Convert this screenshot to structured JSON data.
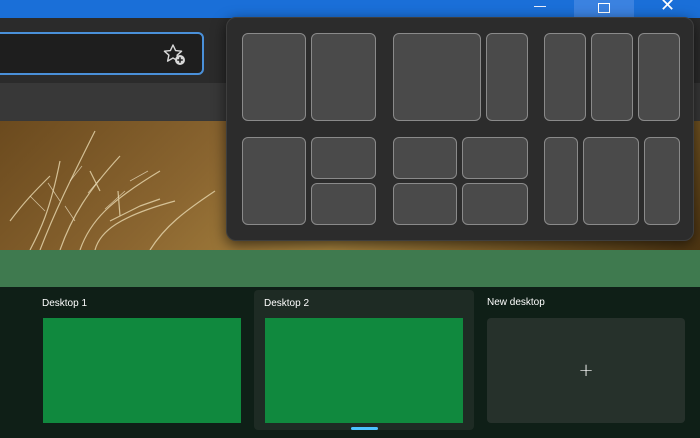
{
  "window_controls": {
    "minimize_icon": "minimize-icon",
    "maximize_icon": "restore-icon",
    "close_glyph": "✕"
  },
  "address_bar": {
    "value": "",
    "favorite_icon": "add-favorite-icon"
  },
  "snap_layouts": {
    "groups": [
      {
        "name": "two-columns-equal",
        "zones": 2
      },
      {
        "name": "two-columns-wide-left",
        "zones": 2
      },
      {
        "name": "three-columns-equal",
        "zones": 3
      },
      {
        "name": "left-column-right-stack",
        "zones": 3
      },
      {
        "name": "four-grid",
        "zones": 4
      },
      {
        "name": "three-columns-wide-center",
        "zones": 3
      }
    ]
  },
  "task_view": {
    "desktops": [
      {
        "label": "Desktop 1",
        "active": false
      },
      {
        "label": "Desktop 2",
        "active": true
      }
    ],
    "new_desktop": {
      "label": "New desktop",
      "plus": "+"
    }
  },
  "colors": {
    "accent": "#1a6fd8",
    "desktop_thumb": "#10893e",
    "band": "#3f7a4f",
    "active_indicator": "#4cc2ff"
  }
}
